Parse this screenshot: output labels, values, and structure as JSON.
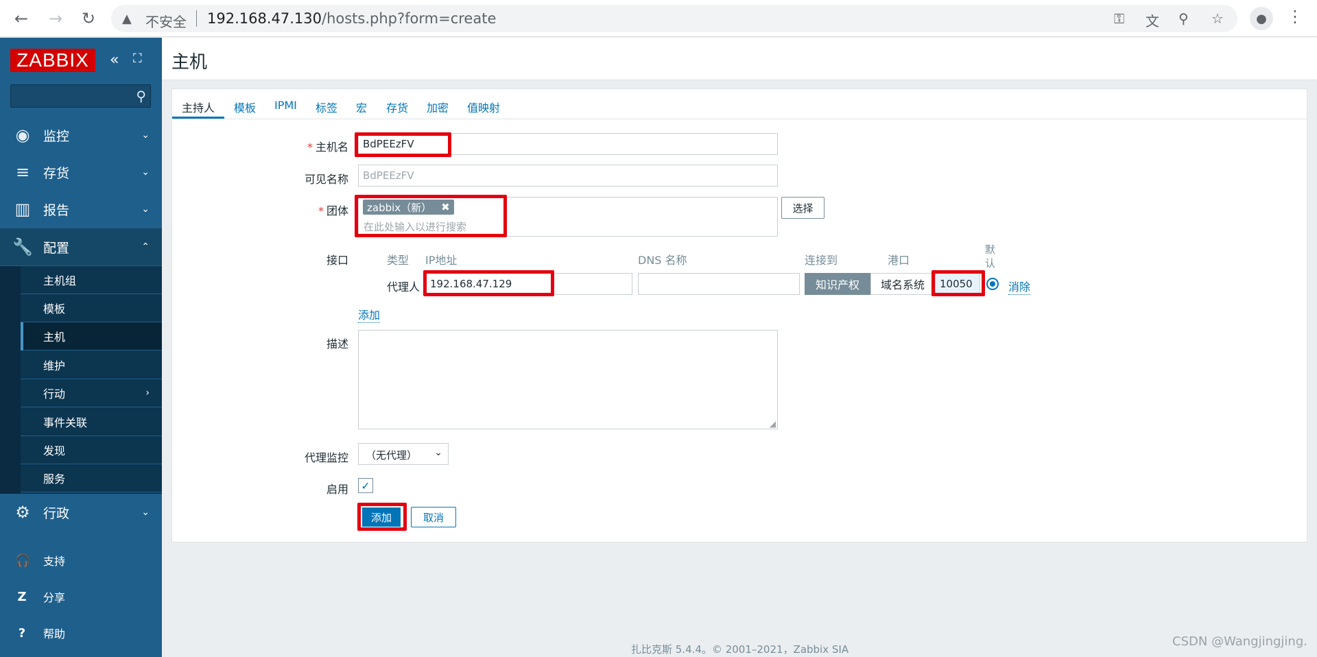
{
  "browser": {
    "back_icon": "←",
    "forward_icon": "→",
    "reload_icon": "↻",
    "security_label": "不安全",
    "url_host": "192.168.47.130",
    "url_path": "/hosts.php?form=create"
  },
  "sidebar": {
    "logo": "ZABBIX",
    "collapse_icon": "«",
    "kiosk_icon": "⛶",
    "search_icon": "⚲",
    "menu": [
      {
        "label": "监控",
        "icon": "◉"
      },
      {
        "label": "存货",
        "icon": "≡"
      },
      {
        "label": "报告",
        "icon": "▥"
      },
      {
        "label": "配置",
        "icon": "🔧"
      }
    ],
    "submenu": [
      {
        "label": "主机组"
      },
      {
        "label": "模板"
      },
      {
        "label": "主机"
      },
      {
        "label": "维护"
      },
      {
        "label": "行动"
      },
      {
        "label": "事件关联"
      },
      {
        "label": "发现"
      },
      {
        "label": "服务"
      }
    ],
    "admin": {
      "label": "行政",
      "icon": "⚙"
    },
    "bottom": [
      {
        "label": "支持",
        "icon": "🎧"
      },
      {
        "label": "分享",
        "icon": "Z"
      },
      {
        "label": "帮助",
        "icon": "?"
      }
    ]
  },
  "page": {
    "title": "主机"
  },
  "tabs": [
    "主持人",
    "模板",
    "IPMI",
    "标签",
    "宏",
    "存货",
    "加密",
    "值映射"
  ],
  "form": {
    "hostname_label": "主机名",
    "hostname_value": "BdPEEzFV",
    "visible_name_label": "可见名称",
    "visible_name_placeholder": "BdPEEzFV",
    "groups_label": "团体",
    "group_chip": "zabbix（新）",
    "groups_placeholder": "在此处输入以进行搜索",
    "select_button": "选择",
    "interfaces_label": "接口",
    "col_type": "类型",
    "col_ip": "IP地址",
    "col_dns": "DNS 名称",
    "col_connect": "连接到",
    "col_port": "港口",
    "col_default": "默认",
    "iface_type": "代理人",
    "iface_ip": "192.168.47.129",
    "connect_ip": "知识产权",
    "connect_dns": "域名系统",
    "iface_port": "10050",
    "remove_link": "消除",
    "add_link": "添加",
    "description_label": "描述",
    "proxy_label": "代理监控",
    "proxy_value": "（无代理）",
    "enabled_label": "启用",
    "add_button": "添加",
    "cancel_button": "取消"
  },
  "footer": "扎比克斯 5.4.4。© 2001–2021，Zabbix SIA",
  "watermark": "CSDN @Wangjingjing."
}
